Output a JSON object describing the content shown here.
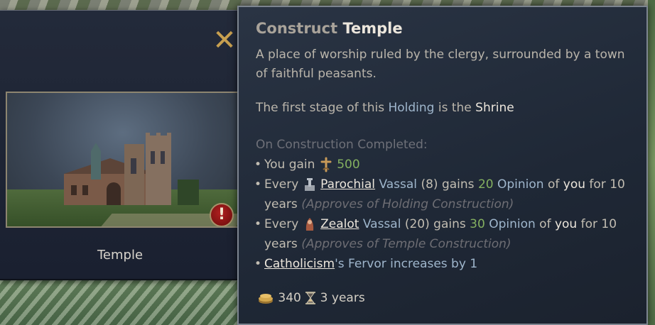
{
  "holding": {
    "name": "Temple",
    "close_label": "✕",
    "warning_label": "!"
  },
  "tooltip": {
    "title_verb": "Construct",
    "title_noun": "Temple",
    "description": "A place of worship ruled by the clergy, surrounded by a town of faithful peasants.",
    "stage_prefix": "The first stage of this",
    "stage_holding": "Holding",
    "stage_middle": "is the",
    "stage_name": "Shrine",
    "completed_header": "On Construction Completed:",
    "effects": {
      "gain": {
        "prefix": "You gain",
        "icon": "piety-icon",
        "value": "500"
      },
      "parochial": {
        "prefix": "Every",
        "icon": "parochial-icon",
        "trait": "Parochial",
        "vassal": "Vassal",
        "count": "(8)",
        "gains": "gains",
        "amount": "20",
        "opinion": "Opinion",
        "of": "of",
        "you": "you",
        "for": "for 10 years",
        "reason": "(Approves of Holding Construction)"
      },
      "zealot": {
        "prefix": "Every",
        "icon": "zealot-icon",
        "trait": "Zealot",
        "vassal": "Vassal",
        "count": "(20)",
        "gains": "gains",
        "amount": "30",
        "opinion": "Opinion",
        "of": "of",
        "you": "you",
        "for": "for 10 years",
        "reason": "(Approves of Temple Construction)"
      },
      "fervor": {
        "faith": "Catholicism",
        "suffix": "'s Fervor increases by 1"
      }
    },
    "cost": {
      "gold_icon": "gold-icon",
      "gold": "340",
      "time_icon": "hourglass-icon",
      "time": "3 years"
    }
  },
  "colors": {
    "highlight": "#9fb6cc",
    "positive": "#84b060",
    "gold_x": "#c8a050",
    "warning": "#b02020"
  }
}
